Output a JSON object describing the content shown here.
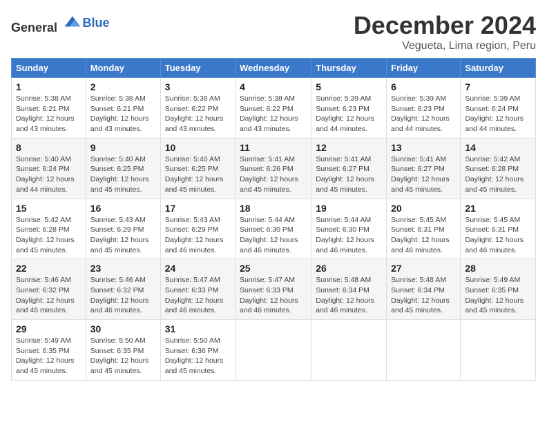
{
  "header": {
    "logo_general": "General",
    "logo_blue": "Blue",
    "title": "December 2024",
    "location": "Vegueta, Lima region, Peru"
  },
  "calendar": {
    "weekdays": [
      "Sunday",
      "Monday",
      "Tuesday",
      "Wednesday",
      "Thursday",
      "Friday",
      "Saturday"
    ],
    "weeks": [
      [
        {
          "day": "1",
          "sunrise": "5:38 AM",
          "sunset": "6:21 PM",
          "daylight": "12 hours and 43 minutes."
        },
        {
          "day": "2",
          "sunrise": "5:38 AM",
          "sunset": "6:21 PM",
          "daylight": "12 hours and 43 minutes."
        },
        {
          "day": "3",
          "sunrise": "5:38 AM",
          "sunset": "6:22 PM",
          "daylight": "12 hours and 43 minutes."
        },
        {
          "day": "4",
          "sunrise": "5:38 AM",
          "sunset": "6:22 PM",
          "daylight": "12 hours and 43 minutes."
        },
        {
          "day": "5",
          "sunrise": "5:39 AM",
          "sunset": "6:23 PM",
          "daylight": "12 hours and 44 minutes."
        },
        {
          "day": "6",
          "sunrise": "5:39 AM",
          "sunset": "6:23 PM",
          "daylight": "12 hours and 44 minutes."
        },
        {
          "day": "7",
          "sunrise": "5:39 AM",
          "sunset": "6:24 PM",
          "daylight": "12 hours and 44 minutes."
        }
      ],
      [
        {
          "day": "8",
          "sunrise": "5:40 AM",
          "sunset": "6:24 PM",
          "daylight": "12 hours and 44 minutes."
        },
        {
          "day": "9",
          "sunrise": "5:40 AM",
          "sunset": "6:25 PM",
          "daylight": "12 hours and 45 minutes."
        },
        {
          "day": "10",
          "sunrise": "5:40 AM",
          "sunset": "6:25 PM",
          "daylight": "12 hours and 45 minutes."
        },
        {
          "day": "11",
          "sunrise": "5:41 AM",
          "sunset": "6:26 PM",
          "daylight": "12 hours and 45 minutes."
        },
        {
          "day": "12",
          "sunrise": "5:41 AM",
          "sunset": "6:27 PM",
          "daylight": "12 hours and 45 minutes."
        },
        {
          "day": "13",
          "sunrise": "5:41 AM",
          "sunset": "6:27 PM",
          "daylight": "12 hours and 45 minutes."
        },
        {
          "day": "14",
          "sunrise": "5:42 AM",
          "sunset": "6:28 PM",
          "daylight": "12 hours and 45 minutes."
        }
      ],
      [
        {
          "day": "15",
          "sunrise": "5:42 AM",
          "sunset": "6:28 PM",
          "daylight": "12 hours and 45 minutes."
        },
        {
          "day": "16",
          "sunrise": "5:43 AM",
          "sunset": "6:29 PM",
          "daylight": "12 hours and 45 minutes."
        },
        {
          "day": "17",
          "sunrise": "5:43 AM",
          "sunset": "6:29 PM",
          "daylight": "12 hours and 46 minutes."
        },
        {
          "day": "18",
          "sunrise": "5:44 AM",
          "sunset": "6:30 PM",
          "daylight": "12 hours and 46 minutes."
        },
        {
          "day": "19",
          "sunrise": "5:44 AM",
          "sunset": "6:30 PM",
          "daylight": "12 hours and 46 minutes."
        },
        {
          "day": "20",
          "sunrise": "5:45 AM",
          "sunset": "6:31 PM",
          "daylight": "12 hours and 46 minutes."
        },
        {
          "day": "21",
          "sunrise": "5:45 AM",
          "sunset": "6:31 PM",
          "daylight": "12 hours and 46 minutes."
        }
      ],
      [
        {
          "day": "22",
          "sunrise": "5:46 AM",
          "sunset": "6:32 PM",
          "daylight": "12 hours and 46 minutes."
        },
        {
          "day": "23",
          "sunrise": "5:46 AM",
          "sunset": "6:32 PM",
          "daylight": "12 hours and 46 minutes."
        },
        {
          "day": "24",
          "sunrise": "5:47 AM",
          "sunset": "6:33 PM",
          "daylight": "12 hours and 46 minutes."
        },
        {
          "day": "25",
          "sunrise": "5:47 AM",
          "sunset": "6:33 PM",
          "daylight": "12 hours and 46 minutes."
        },
        {
          "day": "26",
          "sunrise": "5:48 AM",
          "sunset": "6:34 PM",
          "daylight": "12 hours and 46 minutes."
        },
        {
          "day": "27",
          "sunrise": "5:48 AM",
          "sunset": "6:34 PM",
          "daylight": "12 hours and 45 minutes."
        },
        {
          "day": "28",
          "sunrise": "5:49 AM",
          "sunset": "6:35 PM",
          "daylight": "12 hours and 45 minutes."
        }
      ],
      [
        {
          "day": "29",
          "sunrise": "5:49 AM",
          "sunset": "6:35 PM",
          "daylight": "12 hours and 45 minutes."
        },
        {
          "day": "30",
          "sunrise": "5:50 AM",
          "sunset": "6:35 PM",
          "daylight": "12 hours and 45 minutes."
        },
        {
          "day": "31",
          "sunrise": "5:50 AM",
          "sunset": "6:36 PM",
          "daylight": "12 hours and 45 minutes."
        },
        null,
        null,
        null,
        null
      ]
    ]
  }
}
